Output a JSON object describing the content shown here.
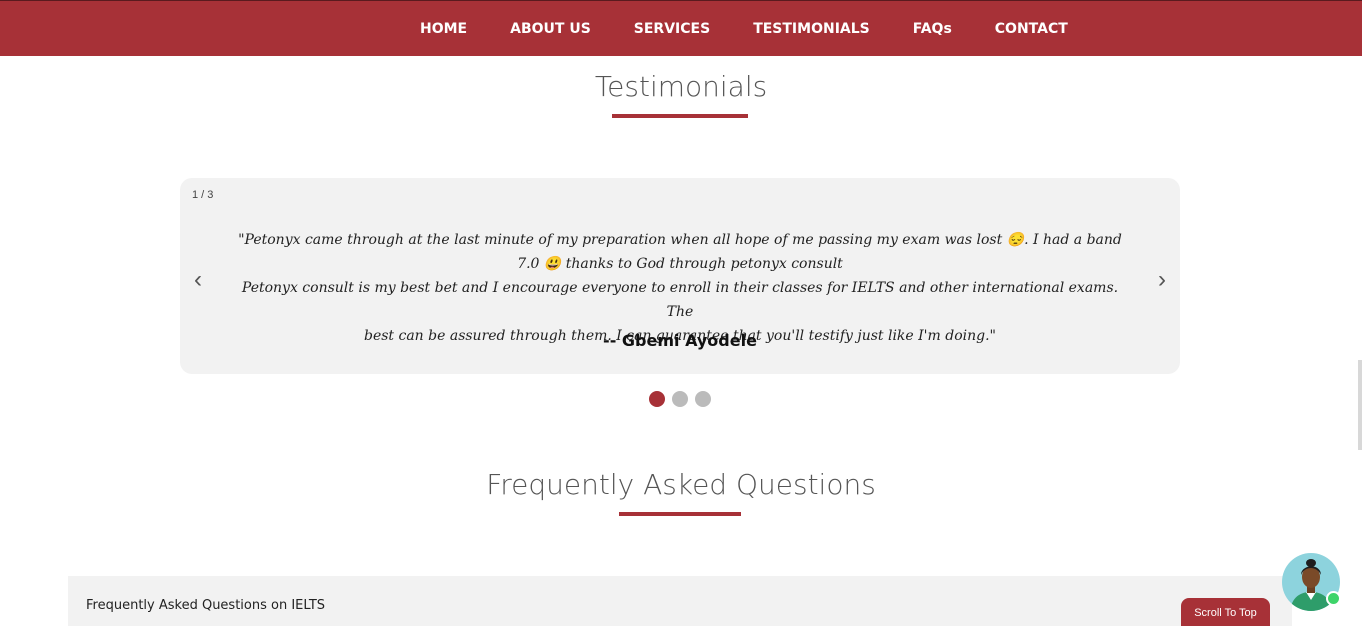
{
  "nav": {
    "items": [
      "HOME",
      "ABOUT US",
      "SERVICES",
      "TESTIMONIALS",
      "FAQs",
      "CONTACT"
    ]
  },
  "testimonials": {
    "title": "Testimonials",
    "counter": "1 / 3",
    "quote_lines": [
      "\"Petonyx came through at the last minute of my preparation when all hope of me passing my exam was lost 😔. I had a band",
      "7.0 😃 thanks to God through petonyx consult",
      "Petonyx consult is my best bet and I encourage everyone to enroll in their classes for IELTS and other international exams. The",
      "best can be assured through them. I can guarantee that you'll testify just like I'm doing.\""
    ],
    "author": "-- Gbemi Ayodele",
    "prev_icon": "‹",
    "next_icon": "›",
    "active_slide": 1,
    "total_slides": 3
  },
  "faq": {
    "title": "Frequently Asked Questions",
    "first_item": "Frequently Asked Questions on IELTS"
  },
  "scroll_top": {
    "label": "Scroll To Top"
  },
  "colors": {
    "brand": "#a73137",
    "panel": "#f2f2f2",
    "online": "#3ed46a"
  },
  "icons": {
    "chat_avatar": "chat-avatar-icon",
    "online": "online-status-icon"
  }
}
